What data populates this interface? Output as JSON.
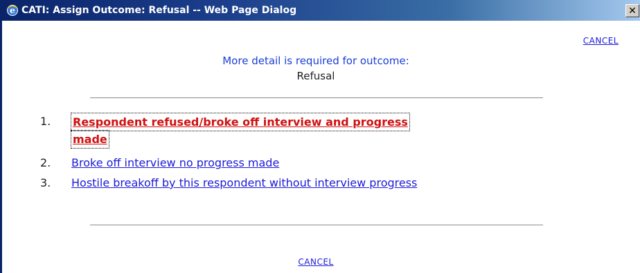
{
  "window": {
    "title": "CATI: Assign Outcome: Refusal -- Web Page Dialog",
    "close_glyph": "✕",
    "title_icon": "ie-icon",
    "accent_color": "#0a246a"
  },
  "dialog": {
    "cancel_top_label": "CANCEL",
    "heading": "More detail is required for outcome:",
    "outcome": "Refusal",
    "options": [
      {
        "number": "1.",
        "label_line1": "Respondent refused/broke off interview and progress",
        "label_line2": "made",
        "selected": true
      },
      {
        "number": "2.",
        "label": "Broke off interview no progress made",
        "selected": false
      },
      {
        "number": "3.",
        "label": "Hostile breakoff by this respondent without interview progress",
        "selected": false
      }
    ],
    "cancel_bottom_label": "CANCEL",
    "link_color": "#1a1ad8",
    "selected_color": "#d01010"
  }
}
